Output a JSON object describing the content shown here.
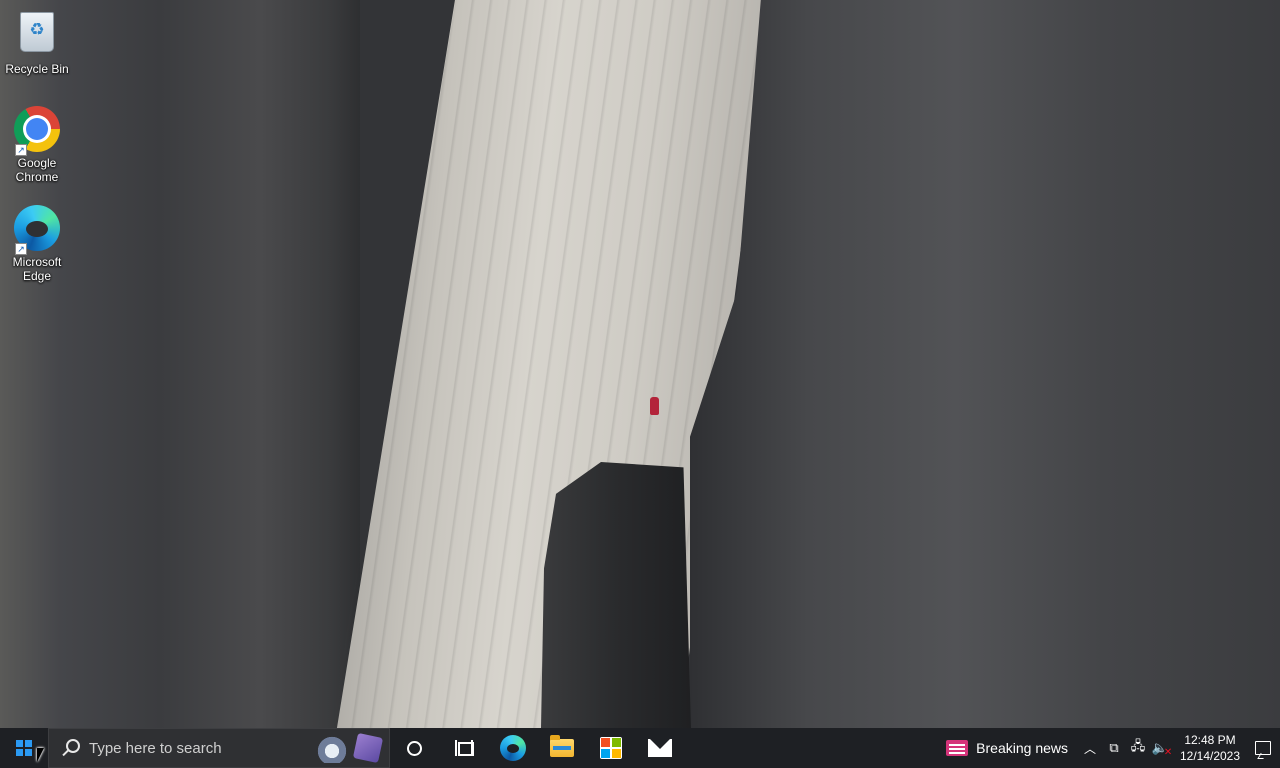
{
  "desktop": {
    "icons": [
      {
        "label": "Recycle Bin",
        "icon": "recycle-bin-icon"
      },
      {
        "label": "Google Chrome",
        "icon": "chrome-icon"
      },
      {
        "label": "Microsoft Edge",
        "icon": "edge-icon"
      }
    ]
  },
  "taskbar": {
    "search": {
      "placeholder": "Type here to search"
    },
    "pinned": [
      "cortana-icon",
      "task-view-icon",
      "edge-icon",
      "file-explorer-icon",
      "microsoft-store-icon",
      "mail-icon"
    ],
    "news": {
      "label": "Breaking news"
    },
    "clock": {
      "time": "12:48 PM",
      "date": "12/14/2023"
    }
  },
  "colors": {
    "taskbar_bg": "#1e2024",
    "search_bg": "#2f3033",
    "accent": "#2b9af3",
    "news_icon": "#d4347a"
  }
}
